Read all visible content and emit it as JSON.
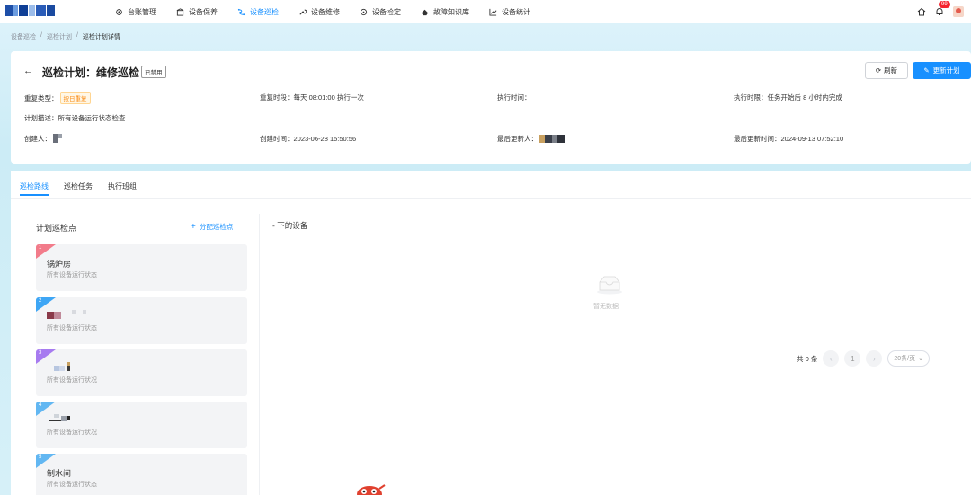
{
  "nav": {
    "items": [
      {
        "label": "台账管理",
        "icon": "gear-icon",
        "active": false
      },
      {
        "label": "设备保养",
        "icon": "building-icon",
        "active": false
      },
      {
        "label": "设备巡检",
        "icon": "route-icon",
        "active": true
      },
      {
        "label": "设备维修",
        "icon": "wrench-icon",
        "active": false
      },
      {
        "label": "设备检定",
        "icon": "target-icon",
        "active": false
      },
      {
        "label": "故障知识库",
        "icon": "knowledge-icon",
        "active": false
      },
      {
        "label": "设备统计",
        "icon": "chart-icon",
        "active": false
      }
    ],
    "badge": "99"
  },
  "breadcrumb": [
    "设备巡检",
    "巡检计划",
    "巡检计划详情"
  ],
  "header": {
    "title": "巡检计划：维修巡检",
    "status_tag": "已禁用",
    "refresh_label": "刷新",
    "update_label": "更新计划",
    "repeat_type_label": "重复类型：",
    "repeat_type_value": "按日重复",
    "repeat_time": "重复时段：每天 08:01:00 执行一次",
    "exec_time": "执行时间：",
    "exec_limit": "执行时限：任务开始后 8 小时内完成",
    "plan_desc": "计划描述：所有设备运行状态检查",
    "creator_label": "创建人：",
    "created_time": "创建时间：2023-06-28 15:50:56",
    "last_updater_label": "最后更新人：",
    "last_updated_time": "最后更新时间：2024-09-13 07:52:10"
  },
  "tabs": [
    {
      "label": "巡检路线",
      "active": true
    },
    {
      "label": "巡检任务",
      "active": false
    },
    {
      "label": "执行班组",
      "active": false
    }
  ],
  "points_panel": {
    "title": "计划巡检点",
    "assign_label": "分配巡检点",
    "points": [
      {
        "index": "1",
        "name": "锅炉房",
        "desc": "所有设备运行状态",
        "color": "#f27b8a"
      },
      {
        "index": "2",
        "name": "",
        "desc": "所有设备运行状态",
        "color": "#3ea6f5"
      },
      {
        "index": "3",
        "name": "",
        "desc": "所有设备运行状况",
        "color": "#a77bf0"
      },
      {
        "index": "4",
        "name": "",
        "desc": "所有设备运行状况",
        "color": "#62b7f2"
      },
      {
        "index": "5",
        "name": "制水间",
        "desc": "所有设备运行状态",
        "color": "#62b7f2"
      }
    ]
  },
  "devices_panel": {
    "title": "- 下的设备",
    "empty_text": "暂无数据"
  },
  "pagination": {
    "total": "共 0 条",
    "current_page": "1",
    "page_size": "20条/页"
  }
}
